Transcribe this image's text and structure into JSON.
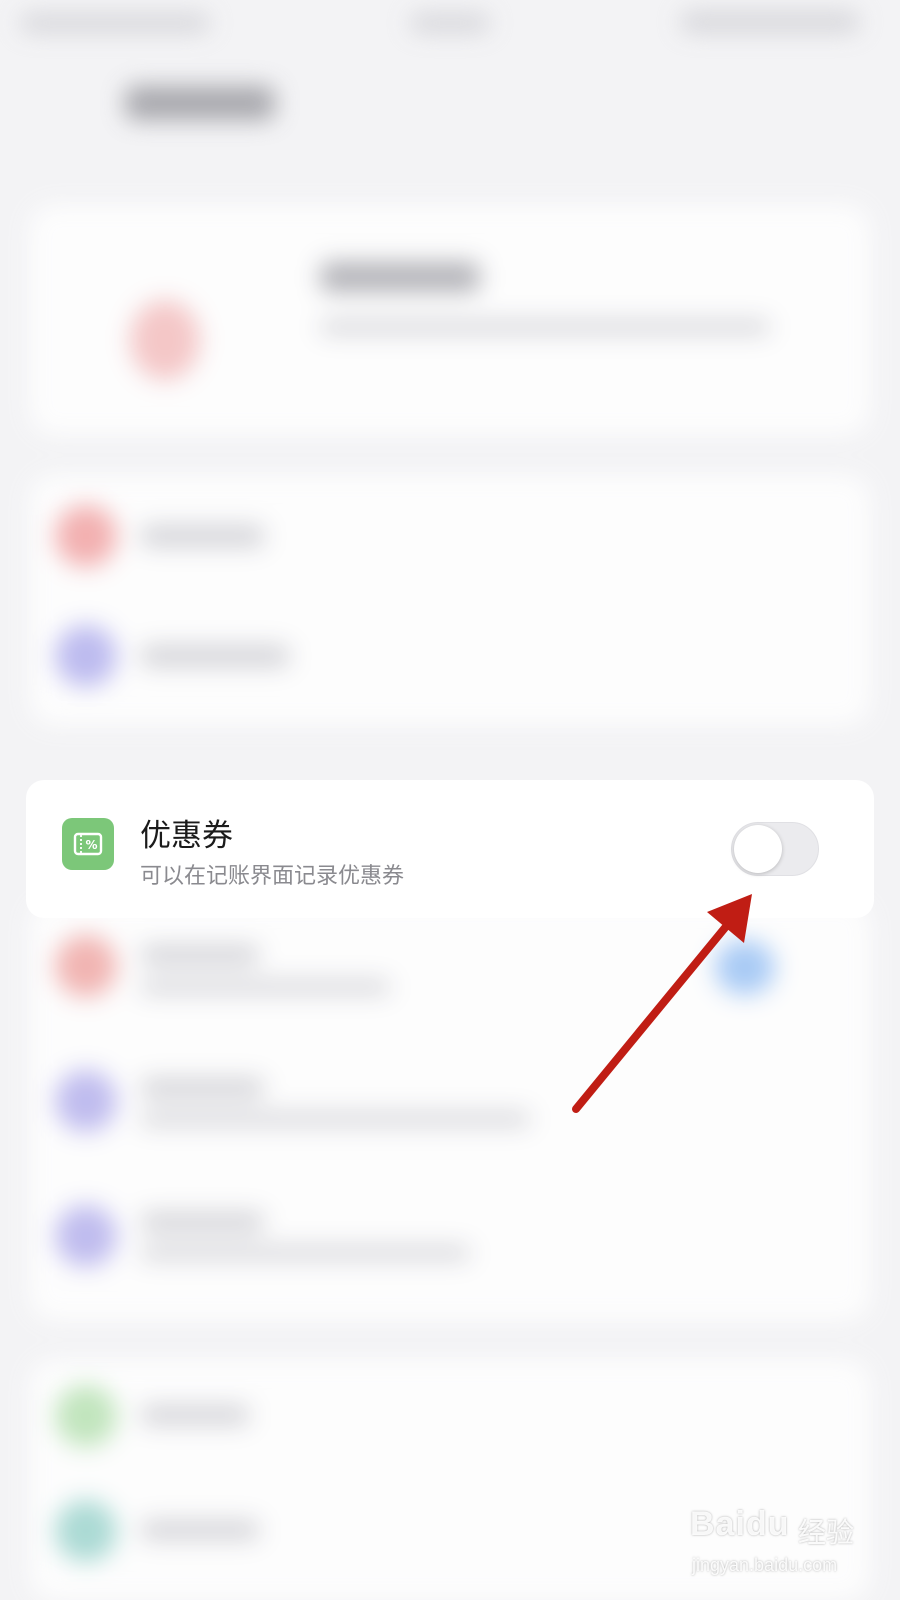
{
  "coupon_setting": {
    "title": "优惠券",
    "subtitle": "可以在记账界面记录优惠券",
    "enabled": false,
    "icon": "coupon-percent-icon",
    "icon_color": "#7cc779"
  },
  "annotation": {
    "arrow_color": "#c01d14"
  },
  "watermark": {
    "brand": "Baidu",
    "brand_cn": "经验",
    "url": "jingyan.baidu.com"
  }
}
